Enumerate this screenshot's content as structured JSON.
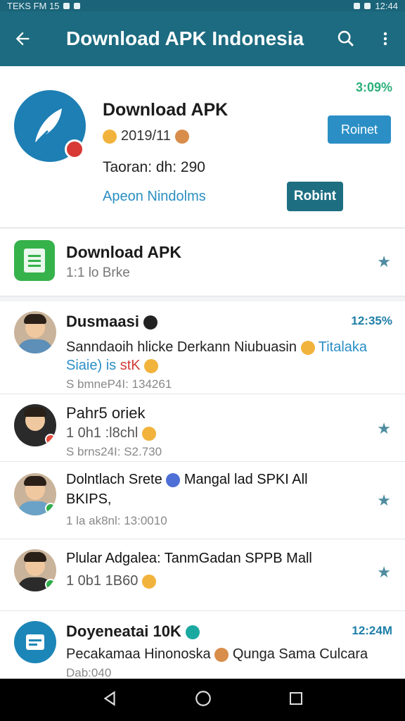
{
  "status_bar": {
    "left_text": "TEKS FM 15",
    "right_text": "12:44"
  },
  "toolbar": {
    "title": "Download APK Indonesia",
    "back_icon": "arrow-left-icon",
    "search_icon": "search-icon",
    "menu_icon": "more-vert-icon"
  },
  "featured": {
    "percent": "3:09%",
    "name": "Download APK",
    "meta": "2019/11",
    "size": "Taoran: dh: 290",
    "developer": "Apeon Nindolms",
    "install_label": "Roinet",
    "open_label": "Robint"
  },
  "card2": {
    "title": "Download APK",
    "subtitle": "1:1 lo Brke"
  },
  "list": [
    {
      "name": "Dusmaasi",
      "time": "12:35%",
      "text": "Sanndaoih hlicke Derkann Niubuasin",
      "text_blue": "Titalaka",
      "text_line2": "Siaie) is",
      "text_red": "stK",
      "meta": "S bmneP4I: 134261"
    },
    {
      "name": "Pahr5 oriek",
      "text": "1 0h1 :l8chl",
      "meta": "S brns24I: S2.730"
    },
    {
      "name": "Dolntlach Srete",
      "text_tail": "Mangal lad SPKI All",
      "text_line2": "BKIPS,",
      "meta": "1 la ak8nl: 13:0010"
    },
    {
      "name": "Plular Adgalea: TanmGadan SPPB Mall",
      "text": "1 0b1 1B60"
    },
    {
      "name": "Doyeneatai 10K",
      "time": "12:24M",
      "text": "Pecakamaa Hinonoska",
      "text_tail": "Qunga Sama Culcara",
      "meta": "Dab:040"
    }
  ],
  "nav": {
    "back_icon": "nav-back-icon",
    "home_icon": "nav-home-icon",
    "recents_icon": "nav-recents-icon"
  }
}
